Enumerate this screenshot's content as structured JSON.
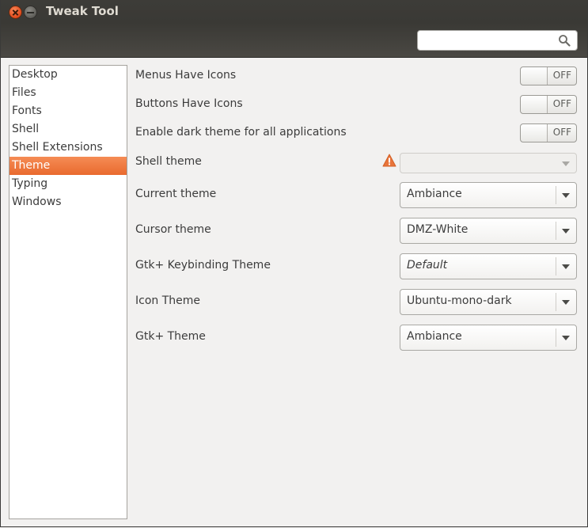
{
  "window": {
    "title": "Tweak Tool"
  },
  "search": {
    "value": "",
    "placeholder": ""
  },
  "sidebar": {
    "items": [
      {
        "label": "Desktop"
      },
      {
        "label": "Files"
      },
      {
        "label": "Fonts"
      },
      {
        "label": "Shell"
      },
      {
        "label": "Shell Extensions"
      },
      {
        "label": "Theme",
        "selected": true
      },
      {
        "label": "Typing"
      },
      {
        "label": "Windows"
      }
    ]
  },
  "settings": {
    "menus_icons": {
      "label": "Menus Have Icons",
      "state": "OFF"
    },
    "buttons_icons": {
      "label": "Buttons Have Icons",
      "state": "OFF"
    },
    "dark_theme": {
      "label": "Enable dark theme for all applications",
      "state": "OFF"
    },
    "shell_theme": {
      "label": "Shell theme",
      "value": ""
    },
    "current_theme": {
      "label": "Current theme",
      "value": "Ambiance"
    },
    "cursor_theme": {
      "label": "Cursor theme",
      "value": "DMZ-White"
    },
    "keybinding_theme": {
      "label": "Gtk+ Keybinding Theme",
      "value": "Default"
    },
    "icon_theme": {
      "label": "Icon Theme",
      "value": "Ubuntu-mono-dark"
    },
    "gtk_theme": {
      "label": "Gtk+ Theme",
      "value": "Ambiance"
    }
  },
  "colors": {
    "accent": "#e96a2e",
    "header": "#3c3b37",
    "warning": "#e8743b"
  },
  "icons": {
    "close": "close-icon",
    "minimize": "minimize-icon",
    "search": "search-icon",
    "warning": "warning-icon",
    "dropdown": "chevron-down-icon"
  }
}
